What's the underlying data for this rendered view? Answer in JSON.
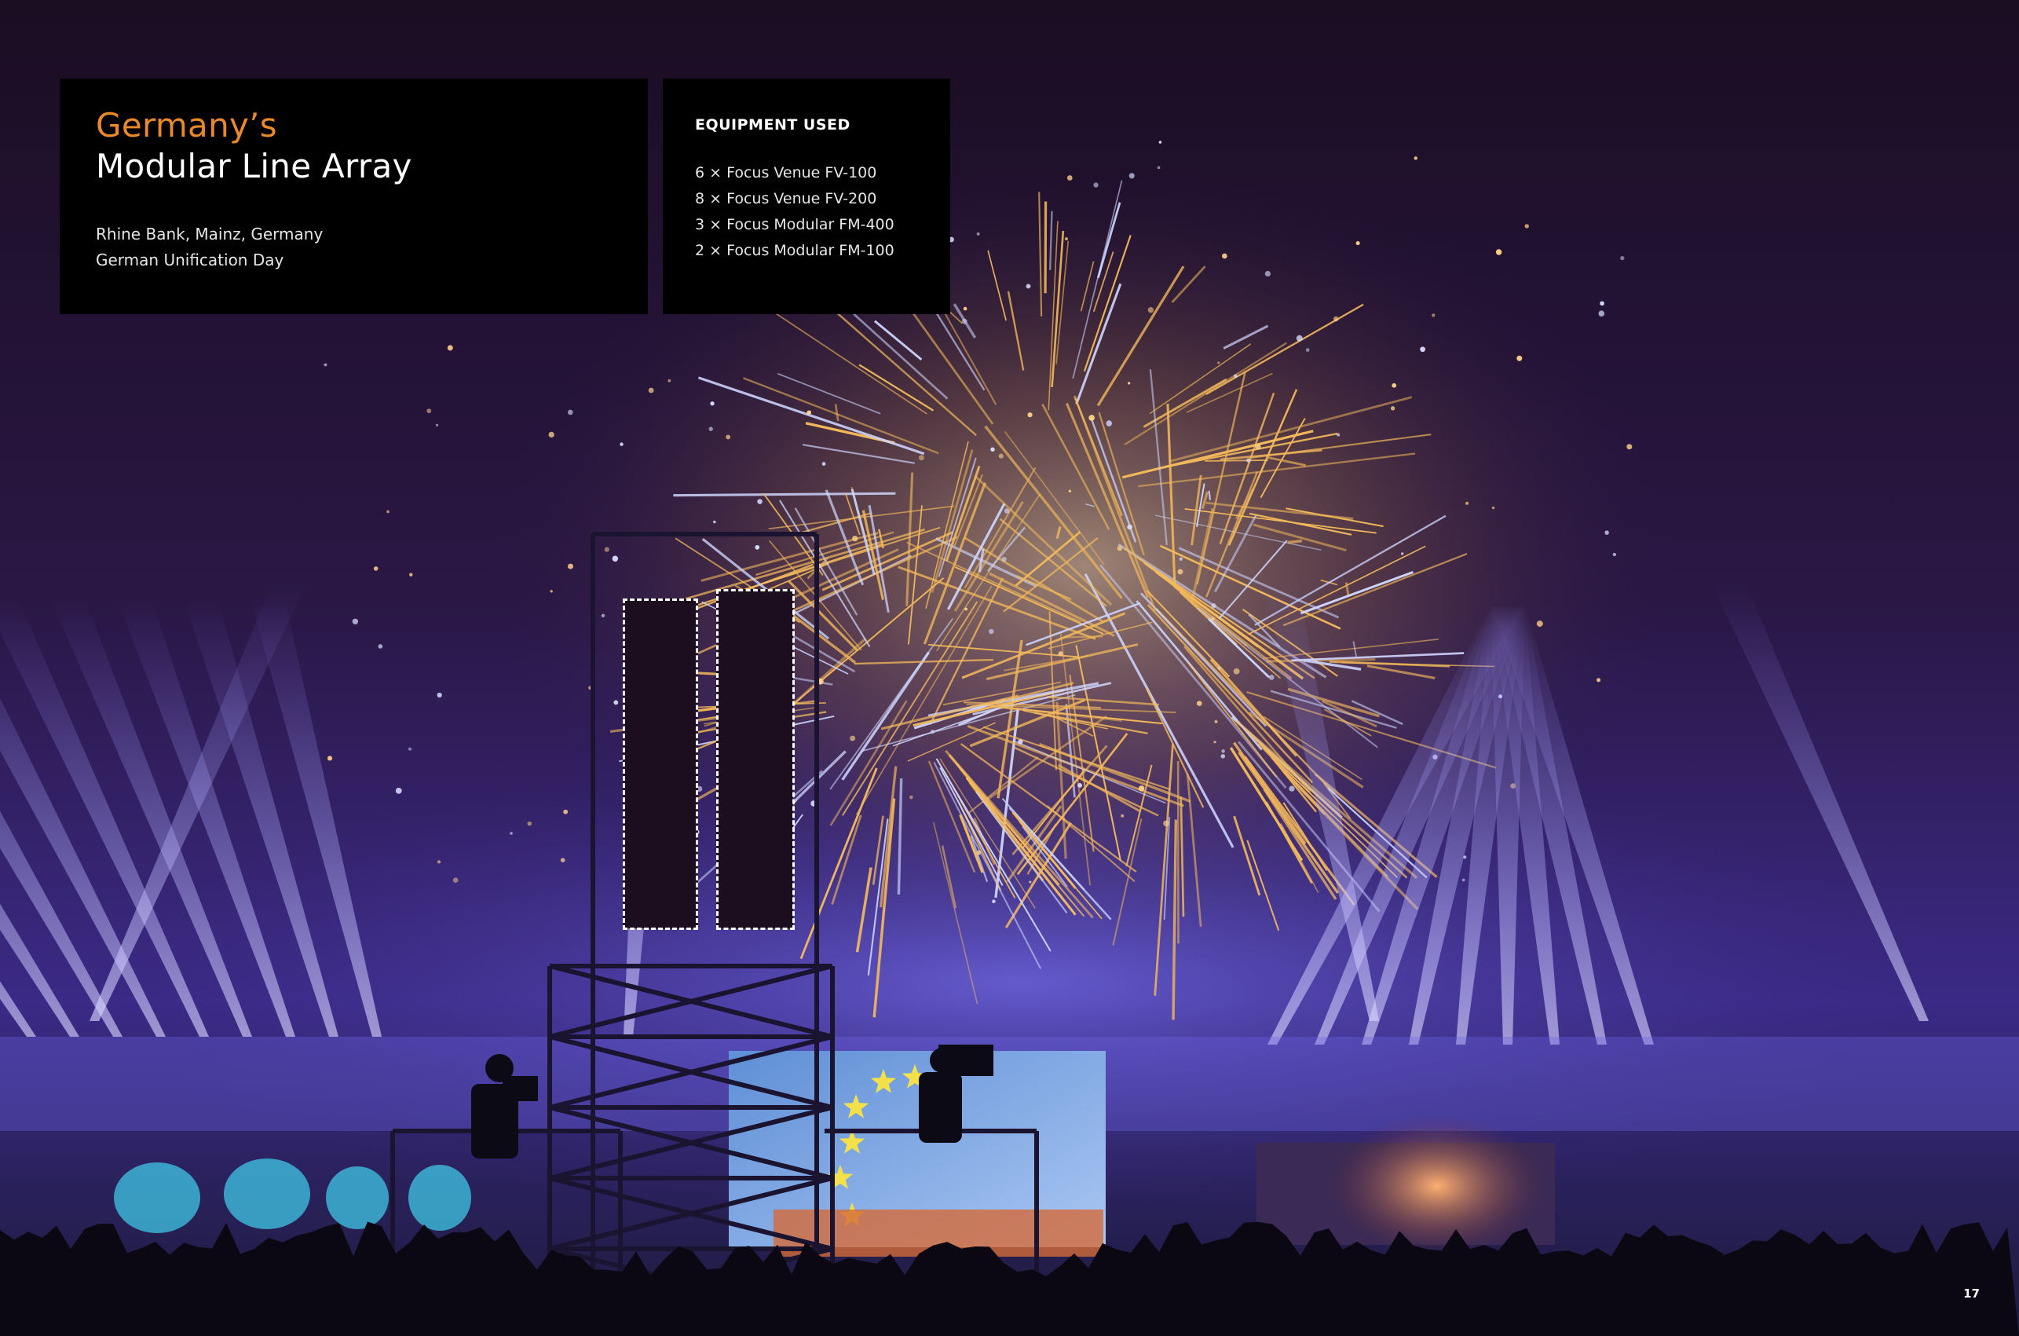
{
  "header": {
    "title_line1": "Germany’s",
    "title_line2": "Modular Line Array",
    "location": "Rhine Bank, Mainz, Germany",
    "event": "German Unification Day"
  },
  "equipment": {
    "heading": "EQUIPMENT USED",
    "items": [
      "6 × Focus Venue FV-100",
      "8 × Focus Venue FV-200",
      "3 × Focus Modular FM-400",
      "2 × Focus Modular FM-100"
    ]
  },
  "page_number": "17",
  "photo": {
    "subject": "fireworks-concert-stage-photo",
    "icons": [
      "eu-flag-star-icon"
    ]
  },
  "colors": {
    "title_accent": "#e9892b",
    "card_background": "#000000",
    "sky": "#1a0f2a"
  }
}
